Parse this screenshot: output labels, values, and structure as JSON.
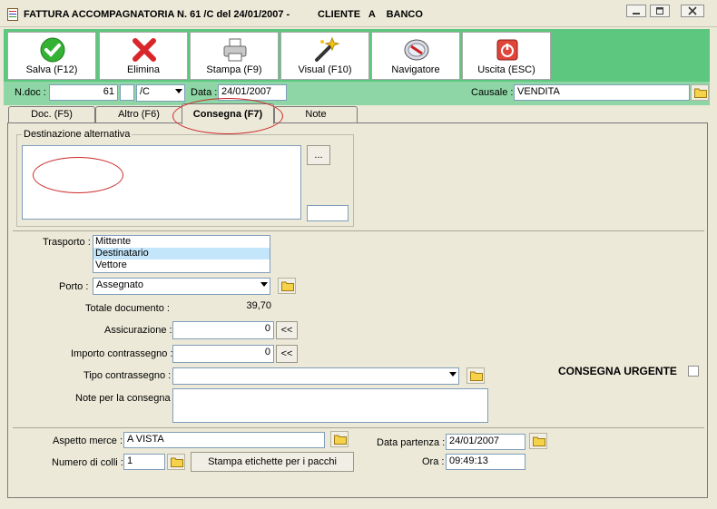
{
  "title": {
    "text": "FATTURA ACCOMPAGNATORIA N. 61 /C del 24/01/2007 -",
    "client": "CLIENTE   A    BANCO"
  },
  "window_controls": {
    "minimize": "▭",
    "restore": "❐",
    "close": "✕"
  },
  "toolbar": {
    "save": "Salva (F12)",
    "delete": "Elimina",
    "print": "Stampa (F9)",
    "visual": "Visual (F10)",
    "navigator": "Navigatore",
    "exit": "Uscita (ESC)"
  },
  "header": {
    "ndoc_label": "N.doc :",
    "ndoc_value": "61",
    "series_value": "/C",
    "date_label": "Data :",
    "date_value": "24/01/2007",
    "causale_label": "Causale :",
    "causale_value": "VENDITA"
  },
  "tabs": [
    {
      "label": "Doc. (F5)"
    },
    {
      "label": "Altro (F6)"
    },
    {
      "label": "Consegna (F7)"
    },
    {
      "label": "Note"
    }
  ],
  "dest": {
    "legend": "Destinazione alternativa",
    "button": "...",
    "address": "",
    "code": ""
  },
  "form": {
    "trasporto_label": "Trasporto :",
    "trasporto_options": [
      "Mittente",
      "Destinatario",
      "Vettore"
    ],
    "trasporto_selected": "Destinatario",
    "porto_label": "Porto :",
    "porto_value": "Assegnato",
    "totale_label": "Totale documento :",
    "totale_value": "39,70",
    "assicurazione_label": "Assicurazione :",
    "assicurazione_value": "0",
    "contrassegno_label": "Importo contrassegno :",
    "contrassegno_value": "0",
    "tipo_contrassegno_label": "Tipo contrassegno :",
    "tipo_contrassegno_value": "",
    "note_label": "Note per la consegna",
    "note_value": "",
    "urgente_label": "CONSEGNA URGENTE",
    "urgente_checked": false,
    "arrows": "<<"
  },
  "bottom": {
    "aspetto_label": "Aspetto merce :",
    "aspetto_value": "A VISTA",
    "colli_label": "Numero di colli :",
    "colli_value": "1",
    "etichette_button": "Stampa etichette per i pacchi",
    "data_partenza_label": "Data partenza :",
    "data_partenza_value": "24/01/2007",
    "ora_label": "Ora :",
    "ora_value": "09:49:13"
  },
  "colors": {
    "toolbar_green": "#5ec77f",
    "header_green": "#8ed6a5",
    "window_bg": "#ece9d8",
    "annotation_red": "#cc2b2b"
  }
}
